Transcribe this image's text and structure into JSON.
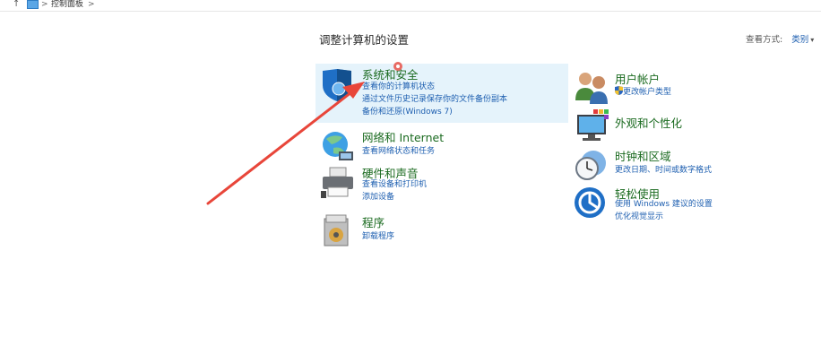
{
  "address_bar": {
    "up_glyph": "↑",
    "separator": ">",
    "crumb": "控制面板"
  },
  "page": {
    "title": "调整计算机的设置",
    "view_label": "查看方式:",
    "view_value": "类别",
    "view_caret": "▾"
  },
  "categories": {
    "security": {
      "title": "系统和安全",
      "links": [
        "查看你的计算机状态",
        "通过文件历史记录保存你的文件备份副本",
        "备份和还原(Windows 7)"
      ]
    },
    "network": {
      "title": "网络和 Internet",
      "links": [
        "查看网络状态和任务"
      ]
    },
    "hardware": {
      "title": "硬件和声音",
      "links": [
        "查看设备和打印机",
        "添加设备"
      ]
    },
    "programs": {
      "title": "程序",
      "links": [
        "卸载程序"
      ]
    },
    "accounts": {
      "title": "用户帐户",
      "links": [
        "更改帐户类型"
      ]
    },
    "appearance": {
      "title": "外观和个性化",
      "links": []
    },
    "clock": {
      "title": "时钟和区域",
      "links": [
        "更改日期、时间或数字格式"
      ]
    },
    "ease": {
      "title": "轻松使用",
      "links": [
        "使用 Windows 建议的设置",
        "优化视觉显示"
      ]
    }
  },
  "annotation": {
    "arrow_color": "#e8463a"
  }
}
